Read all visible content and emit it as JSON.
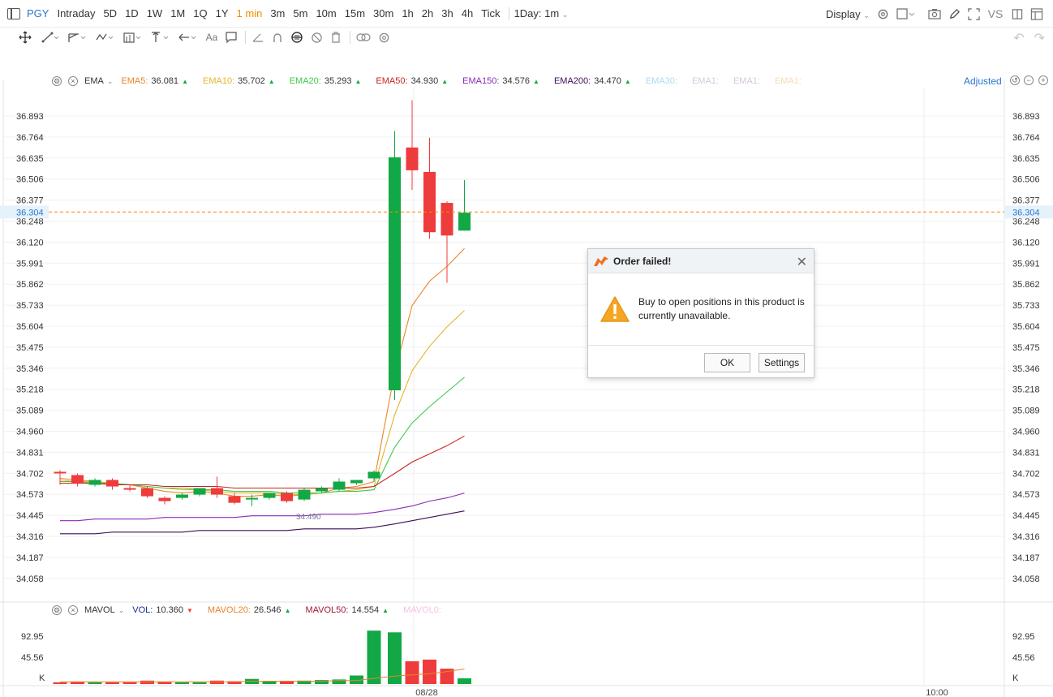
{
  "toolbar": {
    "symbol": "PGY",
    "intervals": [
      "Intraday",
      "5D",
      "1D",
      "1W",
      "1M",
      "1Q",
      "1Y",
      "1 min",
      "3m",
      "5m",
      "10m",
      "15m",
      "30m",
      "1h",
      "2h",
      "3h",
      "4h",
      "Tick"
    ],
    "active_interval": "1 min",
    "range_select": "1Day: 1m",
    "display_label": "Display",
    "vs_label": "VS"
  },
  "main_legend": {
    "indicator": "EMA",
    "items": [
      {
        "label": "EMA5:",
        "value": "36.081",
        "color": "#e8862a",
        "trend": "up"
      },
      {
        "label": "EMA10:",
        "value": "35.702",
        "color": "#e5b52a",
        "trend": "up"
      },
      {
        "label": "EMA20:",
        "value": "35.293",
        "color": "#3cc94a",
        "trend": "up"
      },
      {
        "label": "EMA50:",
        "value": "34.930",
        "color": "#cc2222",
        "trend": "up"
      },
      {
        "label": "EMA150:",
        "value": "34.576",
        "color": "#8a2bb8",
        "trend": "up"
      },
      {
        "label": "EMA200:",
        "value": "34.470",
        "color": "#3a0f55",
        "trend": "up"
      },
      {
        "label": "EMA30:",
        "value": "",
        "color": "#a9dcef",
        "trend": "none"
      },
      {
        "label": "EMA1:",
        "value": "",
        "color": "#d6c8dc",
        "trend": "none"
      },
      {
        "label": "EMA1:",
        "value": "",
        "color": "#d6c8dc",
        "trend": "none"
      },
      {
        "label": "EMA1:",
        "value": "",
        "color": "#f5dcb0",
        "trend": "none"
      }
    ],
    "adjusted_label": "Adjusted"
  },
  "volume_legend": {
    "indicator": "MAVOL",
    "items": [
      {
        "label": "VOL:",
        "value": "10.360",
        "color": "#1a2f8c",
        "trend": "down"
      },
      {
        "label": "MAVOL20:",
        "value": "26.546",
        "color": "#e8862a",
        "trend": "up"
      },
      {
        "label": "MAVOL50:",
        "value": "14.554",
        "color": "#a01a3a",
        "trend": "up"
      },
      {
        "label": "MAVOL0:",
        "value": "",
        "color": "#f4c4e4",
        "trend": "none"
      }
    ]
  },
  "price_axis": {
    "ticks": [
      "36.893",
      "36.764",
      "36.635",
      "36.506",
      "36.377",
      "36.248",
      "36.120",
      "35.991",
      "35.862",
      "35.733",
      "35.604",
      "35.475",
      "35.346",
      "35.218",
      "35.089",
      "34.960",
      "34.831",
      "34.702",
      "34.573",
      "34.445",
      "34.316",
      "34.187",
      "34.058"
    ],
    "current_price": "36.304"
  },
  "volume_axis": {
    "ticks": [
      "92.95",
      "45.56",
      "K"
    ]
  },
  "time_axis": {
    "labels": [
      "08/28",
      "10:00"
    ]
  },
  "chart_data": {
    "type": "candlestick",
    "title": "",
    "up_color": "#12a845",
    "down_color": "#ee3b3b",
    "ylim": [
      34.0,
      37.0
    ],
    "current_price": 36.304,
    "annotation": "34.490",
    "candles": [
      {
        "o": 34.71,
        "h": 34.72,
        "l": 34.63,
        "c": 34.7
      },
      {
        "o": 34.69,
        "h": 34.7,
        "l": 34.62,
        "c": 34.64
      },
      {
        "o": 34.63,
        "h": 34.67,
        "l": 34.62,
        "c": 34.66
      },
      {
        "o": 34.66,
        "h": 34.67,
        "l": 34.6,
        "c": 34.62
      },
      {
        "o": 34.61,
        "h": 34.63,
        "l": 34.59,
        "c": 34.6
      },
      {
        "o": 34.61,
        "h": 34.62,
        "l": 34.55,
        "c": 34.56
      },
      {
        "o": 34.55,
        "h": 34.56,
        "l": 34.51,
        "c": 34.53
      },
      {
        "o": 34.55,
        "h": 34.58,
        "l": 34.54,
        "c": 34.57
      },
      {
        "o": 34.57,
        "h": 34.61,
        "l": 34.56,
        "c": 34.61
      },
      {
        "o": 34.61,
        "h": 34.68,
        "l": 34.55,
        "c": 34.57
      },
      {
        "o": 34.56,
        "h": 34.58,
        "l": 34.51,
        "c": 34.52
      },
      {
        "o": 34.55,
        "h": 34.57,
        "l": 34.5,
        "c": 34.55
      },
      {
        "o": 34.55,
        "h": 34.58,
        "l": 34.54,
        "c": 34.58
      },
      {
        "o": 34.58,
        "h": 34.59,
        "l": 34.52,
        "c": 34.53
      },
      {
        "o": 34.54,
        "h": 34.61,
        "l": 34.53,
        "c": 34.6
      },
      {
        "o": 34.59,
        "h": 34.62,
        "l": 34.58,
        "c": 34.61
      },
      {
        "o": 34.6,
        "h": 34.67,
        "l": 34.59,
        "c": 34.65
      },
      {
        "o": 34.64,
        "h": 34.66,
        "l": 34.63,
        "c": 34.66
      },
      {
        "o": 34.67,
        "h": 34.72,
        "l": 34.65,
        "c": 34.71
      },
      {
        "o": 35.21,
        "h": 36.8,
        "l": 35.15,
        "c": 36.64
      },
      {
        "o": 36.7,
        "h": 36.99,
        "l": 36.44,
        "c": 36.56
      },
      {
        "o": 36.55,
        "h": 36.76,
        "l": 36.14,
        "c": 36.18
      },
      {
        "o": 36.36,
        "h": 36.37,
        "l": 35.87,
        "c": 36.16
      },
      {
        "o": 36.19,
        "h": 36.5,
        "l": 36.19,
        "c": 36.3
      }
    ],
    "series": [
      {
        "name": "EMA5",
        "color": "#e8862a",
        "values": [
          34.67,
          34.66,
          34.65,
          34.64,
          34.63,
          34.61,
          34.59,
          34.58,
          34.59,
          34.58,
          34.56,
          34.56,
          34.57,
          34.56,
          34.57,
          34.58,
          34.61,
          34.62,
          34.65,
          35.32,
          35.73,
          35.88,
          35.97,
          36.08
        ]
      },
      {
        "name": "EMA10",
        "color": "#e5b52a",
        "values": [
          34.66,
          34.65,
          34.65,
          34.64,
          34.63,
          34.62,
          34.61,
          34.6,
          34.6,
          34.59,
          34.58,
          34.58,
          34.58,
          34.57,
          34.57,
          34.58,
          34.59,
          34.6,
          34.62,
          35.06,
          35.33,
          35.48,
          35.6,
          35.7
        ]
      },
      {
        "name": "EMA20",
        "color": "#3cc94a",
        "values": [
          34.65,
          34.65,
          34.64,
          34.64,
          34.63,
          34.62,
          34.61,
          34.61,
          34.6,
          34.6,
          34.59,
          34.59,
          34.59,
          34.58,
          34.58,
          34.58,
          34.59,
          34.59,
          34.6,
          34.86,
          35.01,
          35.11,
          35.2,
          35.29
        ]
      },
      {
        "name": "EMA50",
        "color": "#cc2222",
        "values": [
          34.64,
          34.64,
          34.64,
          34.63,
          34.63,
          34.63,
          34.62,
          34.62,
          34.62,
          34.62,
          34.61,
          34.61,
          34.61,
          34.61,
          34.61,
          34.61,
          34.61,
          34.61,
          34.62,
          34.7,
          34.77,
          34.82,
          34.87,
          34.93
        ]
      },
      {
        "name": "EMA150",
        "color": "#8a2bb8",
        "values": [
          34.41,
          34.41,
          34.42,
          34.42,
          34.42,
          34.42,
          34.43,
          34.43,
          34.43,
          34.43,
          34.43,
          34.44,
          34.44,
          34.44,
          34.44,
          34.45,
          34.45,
          34.45,
          34.46,
          34.48,
          34.5,
          34.53,
          34.55,
          34.58
        ]
      },
      {
        "name": "EMA200",
        "color": "#3a0f55",
        "values": [
          34.33,
          34.33,
          34.33,
          34.34,
          34.34,
          34.34,
          34.34,
          34.34,
          34.35,
          34.35,
          34.35,
          34.35,
          34.35,
          34.35,
          34.36,
          34.36,
          34.36,
          34.36,
          34.37,
          34.39,
          34.41,
          34.43,
          34.45,
          34.47
        ]
      }
    ],
    "volume": {
      "ylim": [
        0,
        110
      ],
      "values": [
        3,
        4,
        3,
        3,
        3,
        6,
        4,
        3,
        3,
        6,
        5,
        9,
        5,
        5,
        6,
        7,
        8,
        15,
        94,
        91,
        40,
        43,
        27,
        10
      ],
      "ma": {
        "name": "MAVOL20",
        "color": "#e8862a",
        "values": [
          4,
          4,
          4,
          4,
          4,
          4,
          4,
          4,
          4,
          4,
          4,
          5,
          5,
          5,
          5,
          5,
          6,
          6,
          10,
          14,
          16,
          18,
          22,
          26.5
        ]
      }
    }
  },
  "dialog": {
    "title": "Order failed!",
    "message": "Buy to open positions in this product is currently unavailable.",
    "ok_label": "OK",
    "settings_label": "Settings"
  }
}
